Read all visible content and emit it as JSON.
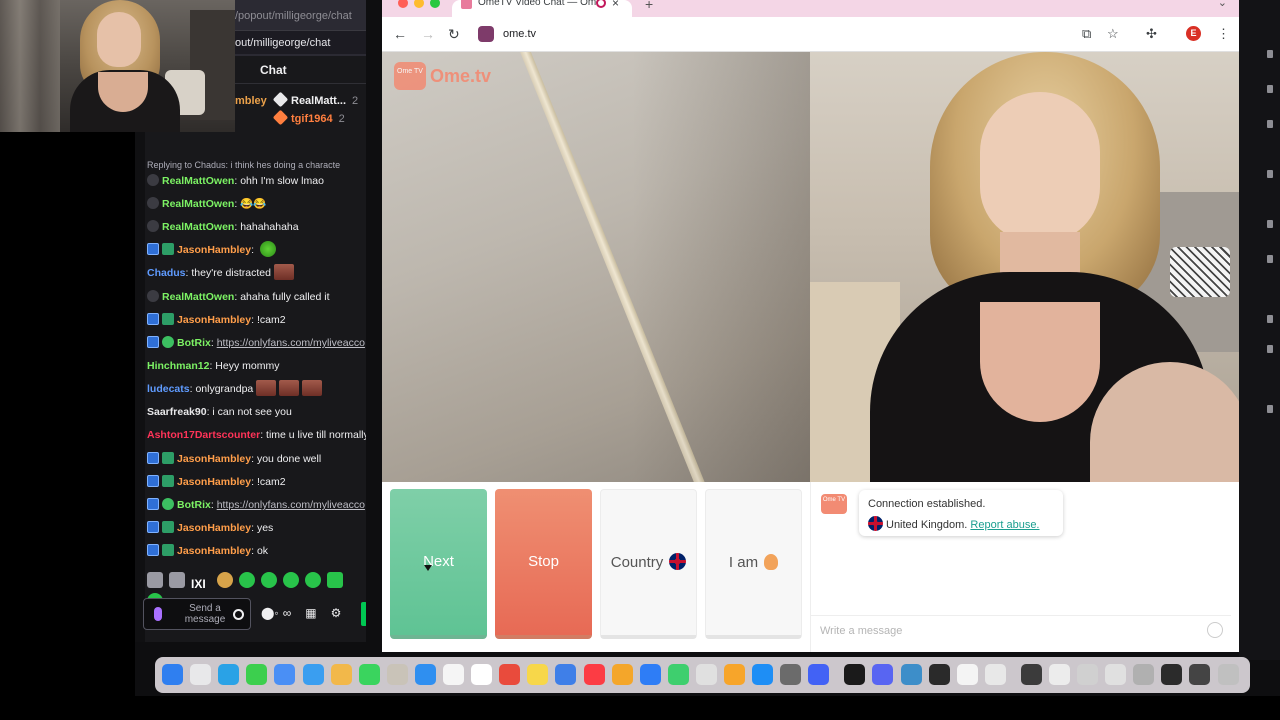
{
  "popout": {
    "url_top": "/popout/milligeorge/chat",
    "url_main": "out/milligeorge/chat"
  },
  "chat_header": {
    "title": "Chat"
  },
  "gifts": [
    {
      "user": "mbley",
      "color": "#eba14a"
    },
    {
      "user": "RealMatt...",
      "count": "2",
      "color": "#efeff1"
    },
    {
      "user": "tgif1964",
      "count": "2",
      "color": "#ff7f3f"
    }
  ],
  "reply_line": "Replying to Chadus: i think hes doing a characte",
  "messages": [
    {
      "badges": [
        "grey"
      ],
      "user": "RealMattOwen",
      "user_color": "#7cf264",
      "text": "ohh I'm slow lmao"
    },
    {
      "badges": [
        "grey"
      ],
      "user": "RealMattOwen",
      "user_color": "#7cf264",
      "text": "😂😂"
    },
    {
      "badges": [
        "grey"
      ],
      "user": "RealMattOwen",
      "user_color": "#7cf264",
      "text": "hahahahaha"
    },
    {
      "badges": [
        "mod",
        "sub"
      ],
      "user": "JasonHambley",
      "user_color": "#ff9e4a",
      "text": "",
      "emote": "green"
    },
    {
      "badges": [],
      "user": "Chadus",
      "user_color": "#5f9bff",
      "text": "they're distracted",
      "emote": "face"
    },
    {
      "badges": [
        "grey"
      ],
      "user": "RealMattOwen",
      "user_color": "#7cf264",
      "text": "ahaha fully called it"
    },
    {
      "badges": [
        "mod",
        "sub"
      ],
      "user": "JasonHambley",
      "user_color": "#ff9e4a",
      "text": "!cam2"
    },
    {
      "badges": [
        "mod",
        "verified"
      ],
      "user": "BotRix",
      "user_color": "#7cf264",
      "text": "https://onlyfans.com/myliveacco",
      "link": true
    },
    {
      "badges": [],
      "user": "Hinchman12",
      "user_color": "#7cf264",
      "text": "Heyy mommy"
    },
    {
      "badges": [],
      "user": "ludecats",
      "user_color": "#5f9bff",
      "text": "onlygrandpa",
      "emote": "face3"
    },
    {
      "badges": [],
      "user": "Saarfreak90",
      "user_color": "#e8e8ea",
      "text": "i can not see you"
    },
    {
      "badges": [],
      "user": "Ashton17Dartscounter",
      "user_color": "#ff3358",
      "text": "time u live till normally"
    },
    {
      "badges": [
        "mod",
        "sub"
      ],
      "user": "JasonHambley",
      "user_color": "#ff9e4a",
      "text": "you done well"
    },
    {
      "badges": [
        "mod",
        "sub"
      ],
      "user": "JasonHambley",
      "user_color": "#ff9e4a",
      "text": "!cam2"
    },
    {
      "badges": [
        "mod",
        "verified"
      ],
      "user": "BotRix",
      "user_color": "#7cf264",
      "text": "https://onlyfans.com/myliveacco",
      "link": true
    },
    {
      "badges": [
        "mod",
        "sub"
      ],
      "user": "JasonHambley",
      "user_color": "#ff9e4a",
      "text": "yes"
    },
    {
      "badges": [
        "mod",
        "sub"
      ],
      "user": "JasonHambley",
      "user_color": "#ff9e4a",
      "text": "ok"
    }
  ],
  "chat_input": {
    "placeholder": "Send a message"
  },
  "browser": {
    "tab_title": "OmeTV Video Chat — Om",
    "url": "ome.tv",
    "profile_initial": "E"
  },
  "ometv": {
    "logo_small": "Ome TV",
    "logo_text": "Ome.tv",
    "buttons": {
      "next": "Next",
      "stop": "Stop",
      "country": "Country",
      "iam": "I am"
    },
    "connection": "Connection established.",
    "location": "United Kingdom.",
    "report": "Report abuse.",
    "message_placeholder": "Write a message"
  },
  "colors": {
    "next": "#5fc394",
    "stop": "#e76a55",
    "accent": "#f28b73",
    "twitch_bg": "#18181b"
  }
}
